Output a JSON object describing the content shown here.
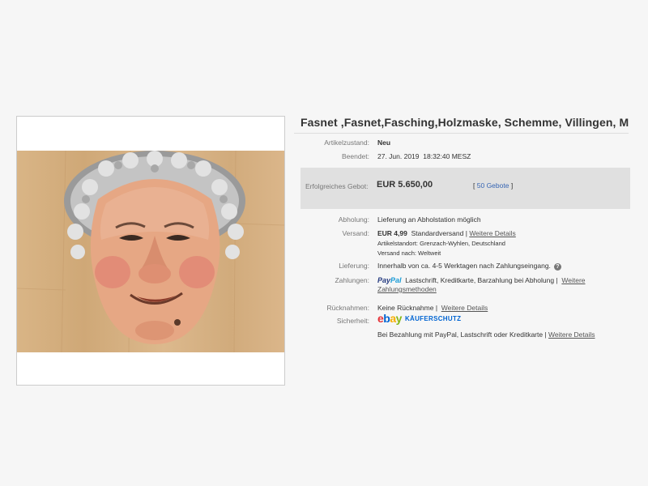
{
  "title": "Fasnet ,Fasnet,Fasching,Holzmaske, Schemme, Villingen, Morbili",
  "item": {
    "condition_label": "Artikelzustand:",
    "condition_value": "Neu",
    "ended_label": "Beendet:",
    "ended_date": "27. Jun. 2019",
    "ended_time": "18:32:40 MESZ"
  },
  "bid": {
    "label": "Erfolgreiches Gebot:",
    "price": "EUR 5.650,00",
    "count_open": "[",
    "count_link": "50 Gebote",
    "count_close": "]"
  },
  "pickup": {
    "label": "Abholung:",
    "value": "Lieferung an Abholstation möglich"
  },
  "shipping": {
    "label": "Versand:",
    "price": "EUR 4,99",
    "method": "Standardversand",
    "separator": "|",
    "details_link": "Weitere Details",
    "location": "Artikelstandort:  Grenzach-Wyhlen, Deutschland",
    "ships_to": "Versand nach:  Weltweit"
  },
  "delivery": {
    "label": "Lieferung:",
    "value": "Innerhalb von ca. 4-5 Werktagen nach Zahlungseingang.",
    "help_icon": "?"
  },
  "payments": {
    "label": "Zahlungen:",
    "paypal_part1": "Pay",
    "paypal_part2": "Pal",
    "methods": "Lastschrift,  Kreditkarte,  Barzahlung bei Abholung  |",
    "link_line1": "Weitere",
    "link_line2": "Zahlungsmethoden"
  },
  "returns": {
    "label": "Rücknahmen:",
    "value": "Keine Rücknahme |",
    "details_link": "Weitere Details"
  },
  "security": {
    "label": "Sicherheit:",
    "ebay_e": "e",
    "ebay_b": "b",
    "ebay_a": "a",
    "ebay_y": "y",
    "buyer_protection": "KÄUFERSCHUTZ",
    "description": "Bei Bezahlung mit PayPal, Lastschrift oder Kreditkarte |",
    "details_link": "Weitere Details"
  },
  "colors": {
    "bid_box": "#e0e0e0",
    "link_blue": "#3665b3",
    "page_bg": "#f6f6f6"
  },
  "icons": {
    "photo": "mask-photo",
    "help": "help-icon",
    "paypal": "paypal-logo",
    "ebay": "ebay-logo"
  }
}
